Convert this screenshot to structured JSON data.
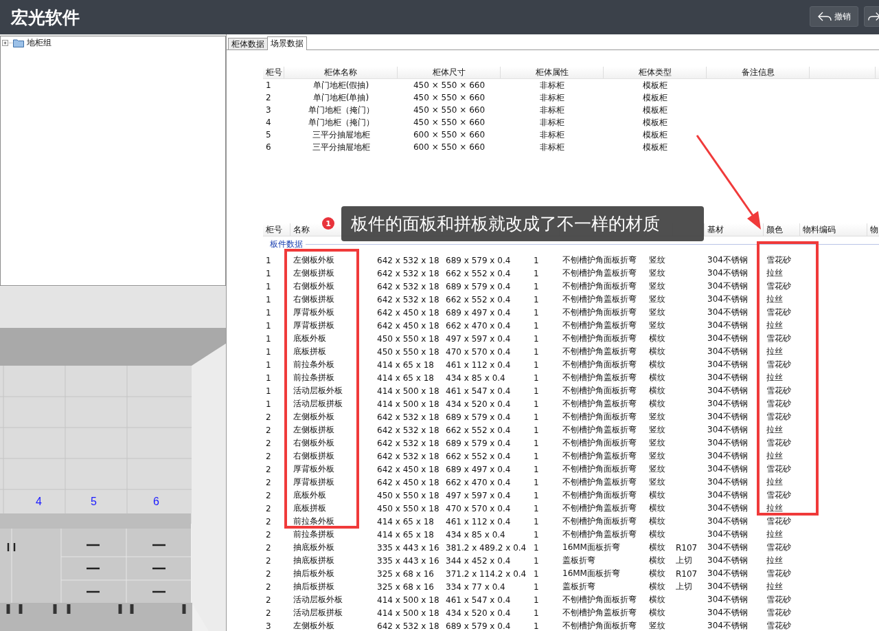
{
  "app": {
    "title": "宏光软件",
    "buttons": [
      {
        "kind": "undo",
        "label": "撤销"
      },
      {
        "kind": "redo"
      }
    ]
  },
  "tree": {
    "items": [
      {
        "label": "地柜组",
        "expanded": false
      }
    ]
  },
  "scene": {
    "kind": "picture",
    "cabinet_labels": [
      "4",
      "5",
      "6"
    ]
  },
  "tabs": [
    {
      "label": "柜体数据",
      "selected": false
    },
    {
      "label": "场景数据",
      "selected": true
    }
  ],
  "cabinet_table": {
    "columns": [
      "柜号",
      "柜体名称",
      "柜体尺寸",
      "柜体属性",
      "柜体类型",
      "备注信息"
    ],
    "rows": [
      [
        "1",
        "单门地柜(假抽)",
        "450 × 550 × 660",
        "非标柜",
        "模板柜"
      ],
      [
        "2",
        "单门地柜(单抽)",
        "450 × 550 × 660",
        "非标柜",
        "模板柜"
      ],
      [
        "3",
        "单门地柜（掩门）",
        "450 × 550 × 660",
        "非标柜",
        "模板柜"
      ],
      [
        "4",
        "单门地柜（掩门）",
        "450 × 550 × 660",
        "非标柜",
        "模板柜"
      ],
      [
        "5",
        "三平分抽屉地柜",
        "600 × 550 × 660",
        "非标柜",
        "模板柜"
      ],
      [
        "6",
        "三平分抽屉地柜",
        "600 × 550 × 660",
        "非标柜",
        "模板柜"
      ]
    ]
  },
  "panel_table": {
    "columns": {
      "no": "柜号",
      "name": "名称",
      "base": "基材",
      "finish": "颜色",
      "column_11": "物料编码",
      "column_12": "物"
    },
    "group_label": "板件数据",
    "rows": [
      {
        "no": "1",
        "name": "左侧板外板",
        "column_3": "642 x 532 x 18",
        "column_4": "689 x 579 x 0.4",
        "column_5": "1",
        "column_6": "不刨槽护角面板折弯",
        "column_7": "竖纹",
        "base": "304不锈钢",
        "finish": "雪花砂"
      },
      {
        "no": "1",
        "name": "左侧板拼板",
        "column_3": "642 x 532 x 18",
        "column_4": "662 x 552 x 0.4",
        "column_5": "1",
        "column_6": "不刨槽护角盖板折弯",
        "column_7": "竖纹",
        "base": "304不锈钢",
        "finish": "拉丝"
      },
      {
        "no": "1",
        "name": "右侧板外板",
        "column_3": "642 x 532 x 18",
        "column_4": "689 x 579 x 0.4",
        "column_5": "1",
        "column_6": "不刨槽护角面板折弯",
        "column_7": "竖纹",
        "base": "304不锈钢",
        "finish": "雪花砂"
      },
      {
        "no": "1",
        "name": "右侧板拼板",
        "column_3": "642 x 532 x 18",
        "column_4": "662 x 552 x 0.4",
        "column_5": "1",
        "column_6": "不刨槽护角盖板折弯",
        "column_7": "竖纹",
        "base": "304不锈钢",
        "finish": "拉丝"
      },
      {
        "no": "1",
        "name": "厚背板外板",
        "column_3": "642 x 450 x 18",
        "column_4": "689 x 497 x 0.4",
        "column_5": "1",
        "column_6": "不刨槽护角面板折弯",
        "column_7": "竖纹",
        "base": "304不锈钢",
        "finish": "雪花砂"
      },
      {
        "no": "1",
        "name": "厚背板拼板",
        "column_3": "642 x 450 x 18",
        "column_4": "662 x 470 x 0.4",
        "column_5": "1",
        "column_6": "不刨槽护角盖板折弯",
        "column_7": "竖纹",
        "base": "304不锈钢",
        "finish": "拉丝"
      },
      {
        "no": "1",
        "name": "底板外板",
        "column_3": "450 x 550 x 18",
        "column_4": "497 x 597 x 0.4",
        "column_5": "1",
        "column_6": "不刨槽护角面板折弯",
        "column_7": "横纹",
        "base": "304不锈钢",
        "finish": "雪花砂"
      },
      {
        "no": "1",
        "name": "底板拼板",
        "column_3": "450 x 550 x 18",
        "column_4": "470 x 570 x 0.4",
        "column_5": "1",
        "column_6": "不刨槽护角盖板折弯",
        "column_7": "横纹",
        "base": "304不锈钢",
        "finish": "拉丝"
      },
      {
        "no": "1",
        "name": "前拉条外板",
        "column_3": "414 x 65 x 18",
        "column_4": "461 x 112 x 0.4",
        "column_5": "1",
        "column_6": "不刨槽护角面板折弯",
        "column_7": "横纹",
        "base": "304不锈钢",
        "finish": "雪花砂"
      },
      {
        "no": "1",
        "name": "前拉条拼板",
        "column_3": "414 x 65 x 18",
        "column_4": "434 x 85 x 0.4",
        "column_5": "1",
        "column_6": "不刨槽护角盖板折弯",
        "column_7": "横纹",
        "base": "304不锈钢",
        "finish": "拉丝"
      },
      {
        "no": "1",
        "name": "活动层板外板",
        "column_3": "414 x 500 x 18",
        "column_4": "461 x 547 x 0.4",
        "column_5": "1",
        "column_6": "不刨槽护角面板折弯",
        "column_7": "横纹",
        "base": "304不锈钢",
        "finish": "雪花砂"
      },
      {
        "no": "1",
        "name": "活动层板拼板",
        "column_3": "414 x 500 x 18",
        "column_4": "434 x 520 x 0.4",
        "column_5": "1",
        "column_6": "不刨槽护角盖板折弯",
        "column_7": "横纹",
        "base": "304不锈钢",
        "finish": "雪花砂"
      },
      {
        "no": "2",
        "name": "左侧板外板",
        "column_3": "642 x 532 x 18",
        "column_4": "689 x 579 x 0.4",
        "column_5": "1",
        "column_6": "不刨槽护角面板折弯",
        "column_7": "竖纹",
        "base": "304不锈钢",
        "finish": "雪花砂"
      },
      {
        "no": "2",
        "name": "左侧板拼板",
        "column_3": "642 x 532 x 18",
        "column_4": "662 x 552 x 0.4",
        "column_5": "1",
        "column_6": "不刨槽护角盖板折弯",
        "column_7": "竖纹",
        "base": "304不锈钢",
        "finish": "拉丝"
      },
      {
        "no": "2",
        "name": "右侧板外板",
        "column_3": "642 x 532 x 18",
        "column_4": "689 x 579 x 0.4",
        "column_5": "1",
        "column_6": "不刨槽护角面板折弯",
        "column_7": "竖纹",
        "base": "304不锈钢",
        "finish": "雪花砂"
      },
      {
        "no": "2",
        "name": "右侧板拼板",
        "column_3": "642 x 532 x 18",
        "column_4": "662 x 552 x 0.4",
        "column_5": "1",
        "column_6": "不刨槽护角盖板折弯",
        "column_7": "竖纹",
        "base": "304不锈钢",
        "finish": "拉丝"
      },
      {
        "no": "2",
        "name": "厚背板外板",
        "column_3": "642 x 450 x 18",
        "column_4": "689 x 497 x 0.4",
        "column_5": "1",
        "column_6": "不刨槽护角面板折弯",
        "column_7": "竖纹",
        "base": "304不锈钢",
        "finish": "雪花砂"
      },
      {
        "no": "2",
        "name": "厚背板拼板",
        "column_3": "642 x 450 x 18",
        "column_4": "662 x 470 x 0.4",
        "column_5": "1",
        "column_6": "不刨槽护角盖板折弯",
        "column_7": "竖纹",
        "base": "304不锈钢",
        "finish": "拉丝"
      },
      {
        "no": "2",
        "name": "底板外板",
        "column_3": "450 x 550 x 18",
        "column_4": "497 x 597 x 0.4",
        "column_5": "1",
        "column_6": "不刨槽护角面板折弯",
        "column_7": "横纹",
        "base": "304不锈钢",
        "finish": "雪花砂"
      },
      {
        "no": "2",
        "name": "底板拼板",
        "column_3": "450 x 550 x 18",
        "column_4": "470 x 570 x 0.4",
        "column_5": "1",
        "column_6": "不刨槽护角盖板折弯",
        "column_7": "横纹",
        "base": "304不锈钢",
        "finish": "拉丝"
      },
      {
        "no": "2",
        "name": "前拉条外板",
        "column_3": "414 x 65 x 18",
        "column_4": "461 x 112 x 0.4",
        "column_5": "1",
        "column_6": "不刨槽护角面板折弯",
        "column_7": "横纹",
        "base": "304不锈钢",
        "finish": "雪花砂"
      },
      {
        "no": "2",
        "name": "前拉条拼板",
        "column_3": "414 x 65 x 18",
        "column_4": "434 x 85 x 0.4",
        "column_5": "1",
        "column_6": "不刨槽护角盖板折弯",
        "column_7": "横纹",
        "base": "304不锈钢",
        "finish": "拉丝"
      },
      {
        "no": "2",
        "name": "抽底板外板",
        "column_3": "335 x 443 x 16",
        "column_4": "381.2 x 489.2 x 0.4",
        "column_5": "1",
        "column_6": "16MM面板折弯",
        "column_7": "横纹",
        "column_8": "R107",
        "base": "304不锈钢",
        "finish": "雪花砂"
      },
      {
        "no": "2",
        "name": "抽底板拼板",
        "column_3": "335 x 443 x 16",
        "column_4": "344 x 452 x 0.4",
        "column_5": "1",
        "column_6": "盖板折弯",
        "column_7": "横纹",
        "column_8": "上切",
        "base": "304不锈钢",
        "finish": "拉丝"
      },
      {
        "no": "2",
        "name": "抽后板外板",
        "column_3": "325 x 68 x 16",
        "column_4": "371.2 x 114.2 x 0.4",
        "column_5": "1",
        "column_6": "16MM面板折弯",
        "column_7": "横纹",
        "column_8": "R107",
        "base": "304不锈钢",
        "finish": "雪花砂"
      },
      {
        "no": "2",
        "name": "抽后板拼板",
        "column_3": "325 x 68 x 16",
        "column_4": "334 x 77 x 0.4",
        "column_5": "1",
        "column_6": "盖板折弯",
        "column_7": "横纹",
        "column_8": "上切",
        "base": "304不锈钢",
        "finish": "拉丝"
      },
      {
        "no": "2",
        "name": "活动层板外板",
        "column_3": "414 x 500 x 18",
        "column_4": "461 x 547 x 0.4",
        "column_5": "1",
        "column_6": "不刨槽护角面板折弯",
        "column_7": "横纹",
        "base": "304不锈钢",
        "finish": "雪花砂"
      },
      {
        "no": "2",
        "name": "活动层板拼板",
        "column_3": "414 x 500 x 18",
        "column_4": "434 x 520 x 0.4",
        "column_5": "1",
        "column_6": "不刨槽护角盖板折弯",
        "column_7": "横纹",
        "base": "304不锈钢",
        "finish": "雪花砂"
      },
      {
        "no": "3",
        "name": "左侧板外板",
        "column_3": "642 x 532 x 18",
        "column_4": "689 x 579 x 0.4",
        "column_5": "1",
        "column_6": "不刨槽护角面板折弯",
        "column_7": "竖纹",
        "base": "304不锈钢",
        "finish": "雪花砂"
      }
    ]
  },
  "annotation": {
    "badge": "1",
    "callout": "板件的面板和拼板就改成了不一样的材质"
  }
}
